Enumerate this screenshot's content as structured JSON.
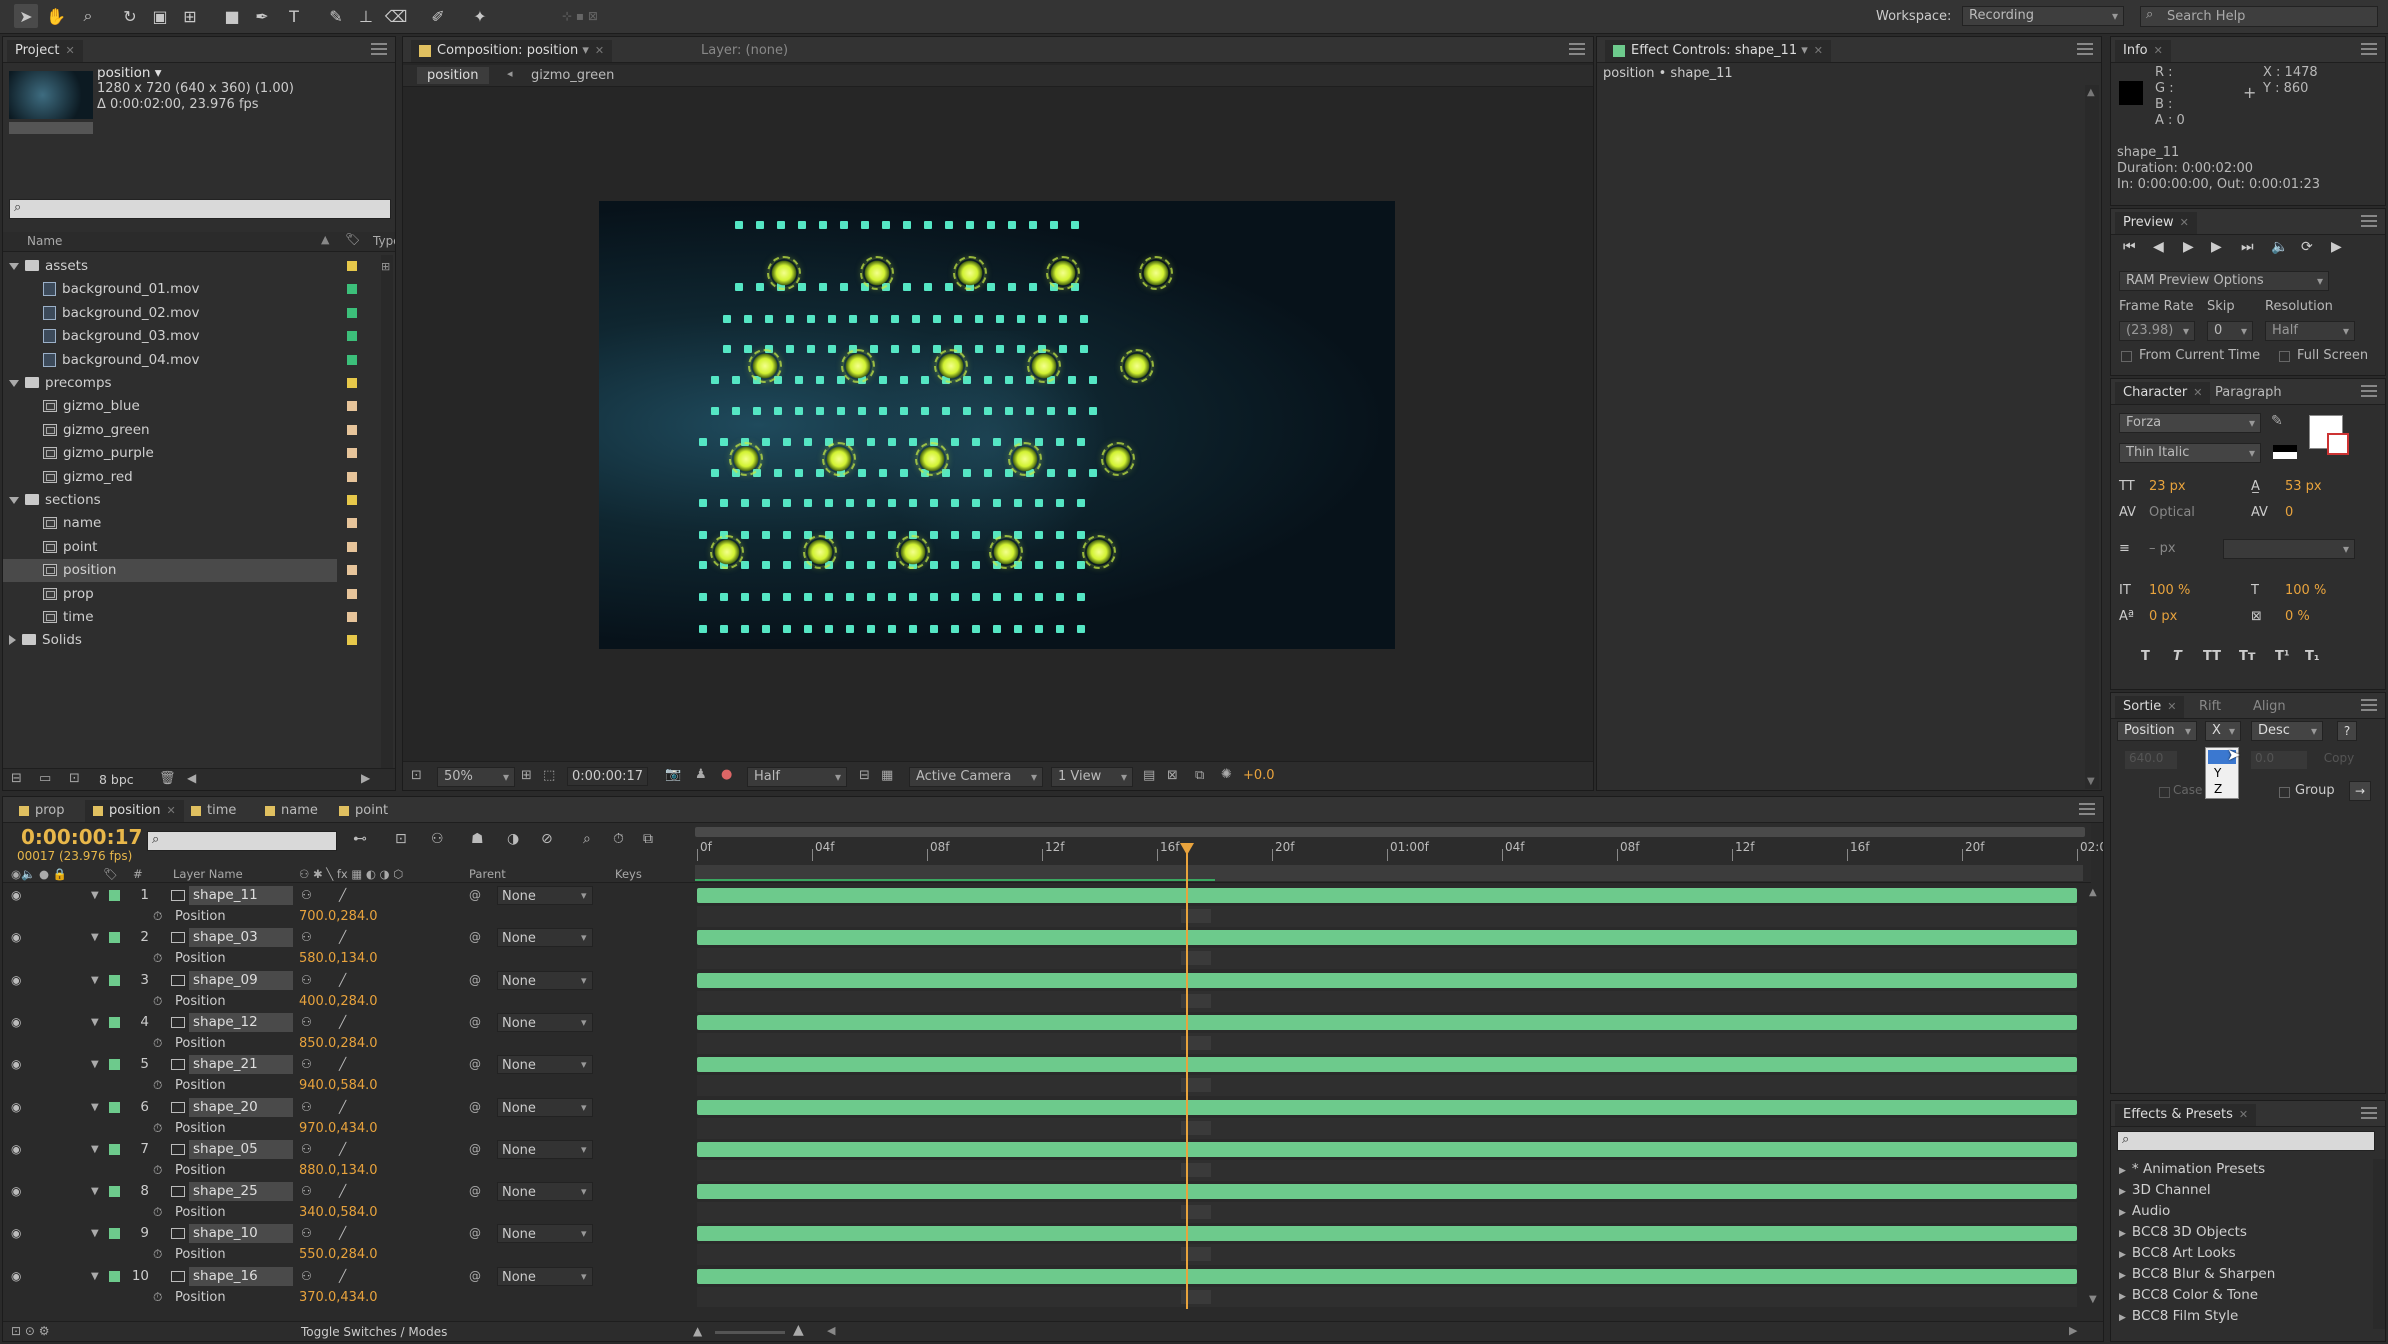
{
  "toolbar": {
    "workspace_label": "Workspace:",
    "workspace_value": "Recording",
    "search_placeholder": "Search Help"
  },
  "project": {
    "tab": "Project",
    "item_name": "position ▾",
    "item_dims": "1280 x 720  (640 x 360) (1.00)",
    "item_duration": "Δ 0:00:02:00, 23.976 fps",
    "col_name": "Name",
    "col_type": "Type",
    "bpc": "8 bpc",
    "tree": [
      {
        "label": "assets",
        "kind": "folder",
        "indent": 0,
        "open": true,
        "color": "#e6c84a"
      },
      {
        "label": "background_01.mov",
        "kind": "file",
        "indent": 1,
        "color": "#3cbf7a"
      },
      {
        "label": "background_02.mov",
        "kind": "file",
        "indent": 1,
        "color": "#3cbf7a"
      },
      {
        "label": "background_03.mov",
        "kind": "file",
        "indent": 1,
        "color": "#3cbf7a"
      },
      {
        "label": "background_04.mov",
        "kind": "file",
        "indent": 1,
        "color": "#3cbf7a"
      },
      {
        "label": "precomps",
        "kind": "folder",
        "indent": 0,
        "open": true,
        "color": "#e6c84a"
      },
      {
        "label": "gizmo_blue",
        "kind": "comp",
        "indent": 1,
        "color": "#e6c49a"
      },
      {
        "label": "gizmo_green",
        "kind": "comp",
        "indent": 1,
        "color": "#e6c49a"
      },
      {
        "label": "gizmo_purple",
        "kind": "comp",
        "indent": 1,
        "color": "#e6c49a"
      },
      {
        "label": "gizmo_red",
        "kind": "comp",
        "indent": 1,
        "color": "#e6c49a"
      },
      {
        "label": "sections",
        "kind": "folder",
        "indent": 0,
        "open": true,
        "color": "#e6c84a"
      },
      {
        "label": "name",
        "kind": "comp",
        "indent": 1,
        "color": "#e6c49a"
      },
      {
        "label": "point",
        "kind": "comp",
        "indent": 1,
        "color": "#e6c49a"
      },
      {
        "label": "position",
        "kind": "comp",
        "indent": 1,
        "color": "#e6c49a",
        "selected": true
      },
      {
        "label": "prop",
        "kind": "comp",
        "indent": 1,
        "color": "#e6c49a"
      },
      {
        "label": "time",
        "kind": "comp",
        "indent": 1,
        "color": "#e6c49a"
      },
      {
        "label": "Solids",
        "kind": "folder",
        "indent": 0,
        "open": false,
        "color": "#e6c84a"
      }
    ]
  },
  "comp": {
    "tab": "Composition: position",
    "layer_tab": "Layer: (none)",
    "crumb1": "position",
    "crumb2": "gizmo_green",
    "zoom": "50%",
    "timecode": "0:00:00:17",
    "resolution": "Half",
    "camera": "Active Camera",
    "view": "1 View",
    "exposure": "+0.0"
  },
  "effect": {
    "tab": "Effect Controls: shape_11",
    "subtitle": "position • shape_11"
  },
  "info": {
    "tab": "Info",
    "r": "R :",
    "g": "G :",
    "b": "B :",
    "a": "A : 0",
    "x": "X : 1478",
    "y": "Y : 860",
    "name": "shape_11",
    "duration": "Duration: 0:00:02:00",
    "inout": "In: 0:00:00:00, Out: 0:00:01:23"
  },
  "preview": {
    "tab": "Preview",
    "ram": "RAM Preview Options",
    "frame_rate_label": "Frame Rate",
    "skip_label": "Skip",
    "resolution_label": "Resolution",
    "frame_rate": "(23.98)",
    "skip": "0",
    "resolution": "Half",
    "from_current": "From Current Time",
    "full_screen": "Full Screen"
  },
  "character": {
    "tab": "Character",
    "tab2": "Paragraph",
    "font": "Forza",
    "style": "Thin Italic",
    "size": "23 px",
    "leading": "53 px",
    "kerning": "Optical",
    "tracking": "0",
    "stroke": "– px",
    "vscale": "100 %",
    "hscale": "100 %",
    "baseline": "0 px",
    "tsume": "0 %"
  },
  "sortie": {
    "tab": "Sortie",
    "tab2": "Rift",
    "tab3": "Align",
    "prop": "Position",
    "axis": "X",
    "order": "Desc",
    "help": "?",
    "field1": "640.0",
    "field2": "0.0",
    "copy": "Copy",
    "case": "Case",
    "group": "Group",
    "menu_y": "Y",
    "menu_z": "Z"
  },
  "effects_presets": {
    "tab": "Effects & Presets",
    "items": [
      "* Animation Presets",
      "3D Channel",
      "Audio",
      "BCC8 3D Objects",
      "BCC8 Art Looks",
      "BCC8 Blur & Sharpen",
      "BCC8 Color & Tone",
      "BCC8 Film Style"
    ]
  },
  "timeline": {
    "tabs": [
      {
        "label": "prop",
        "active": false
      },
      {
        "label": "position",
        "active": true
      },
      {
        "label": "time",
        "active": false
      },
      {
        "label": "name",
        "active": false
      },
      {
        "label": "point",
        "active": false
      }
    ],
    "timecode": "0:00:00:17",
    "frameinfo": "00017 (23.976 fps)",
    "col_layer": "Layer Name",
    "col_parent": "Parent",
    "col_keys": "Keys",
    "toggle": "Toggle Switches / Modes",
    "ruler": [
      "0f",
      "04f",
      "08f",
      "12f",
      "16f",
      "20f",
      "01:00f",
      "04f",
      "08f",
      "12f",
      "16f",
      "20f",
      "02:0"
    ],
    "layers": [
      {
        "num": "1",
        "name": "shape_11",
        "prop": "Position",
        "value": "700.0,284.0",
        "parent": "None"
      },
      {
        "num": "2",
        "name": "shape_03",
        "prop": "Position",
        "value": "580.0,134.0",
        "parent": "None"
      },
      {
        "num": "3",
        "name": "shape_09",
        "prop": "Position",
        "value": "400.0,284.0",
        "parent": "None"
      },
      {
        "num": "4",
        "name": "shape_12",
        "prop": "Position",
        "value": "850.0,284.0",
        "parent": "None"
      },
      {
        "num": "5",
        "name": "shape_21",
        "prop": "Position",
        "value": "940.0,584.0",
        "parent": "None"
      },
      {
        "num": "6",
        "name": "shape_20",
        "prop": "Position",
        "value": "970.0,434.0",
        "parent": "None"
      },
      {
        "num": "7",
        "name": "shape_05",
        "prop": "Position",
        "value": "880.0,134.0",
        "parent": "None"
      },
      {
        "num": "8",
        "name": "shape_25",
        "prop": "Position",
        "value": "340.0,584.0",
        "parent": "None"
      },
      {
        "num": "9",
        "name": "shape_10",
        "prop": "Position",
        "value": "550.0,284.0",
        "parent": "None"
      },
      {
        "num": "10",
        "name": "shape_16",
        "prop": "Position",
        "value": "370.0,434.0",
        "parent": "None"
      }
    ],
    "playhead_fraction": 0.354
  }
}
